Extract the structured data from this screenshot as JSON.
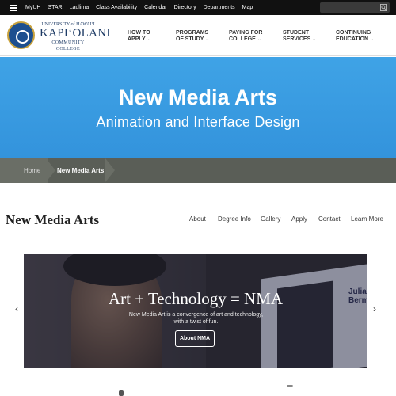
{
  "topbar": {
    "links": [
      "MyUH",
      "STAR",
      "Laulima",
      "Class Availability",
      "Calendar",
      "Directory",
      "Departments",
      "Map"
    ]
  },
  "logo": {
    "small": "UNIVERSITY of HAWAIʻI",
    "big": "KAPIʻOLANI",
    "cc": "COMMUNITY COLLEGE"
  },
  "mainnav": {
    "items": [
      {
        "line1": "HOW TO",
        "line2": "APPLY"
      },
      {
        "line1": "PROGRAMS",
        "line2": "OF STUDY"
      },
      {
        "line1": "PAYING FOR",
        "line2": "COLLEGE"
      },
      {
        "line1": "STUDENT",
        "line2": "SERVICES"
      },
      {
        "line1": "CONTINUING",
        "line2": "EDUCATION"
      }
    ]
  },
  "hero": {
    "title": "New Media Arts",
    "subtitle": "Animation and Interface Design"
  },
  "breadcrumb": {
    "home": "Home",
    "current": "New Media Arts"
  },
  "section": {
    "title": "New Media Arts",
    "links": [
      "About",
      "Degree Info",
      "Gallery",
      "Apply",
      "Contact",
      "Learn More"
    ]
  },
  "slider": {
    "headline": "Art + Technology = NMA",
    "caption": "New Media Art is a convergence of art and technology, with a twist of fun.",
    "button": "About NMA",
    "monitor_text": "Julian Berman"
  },
  "colors": {
    "hero": "#3a9be2",
    "breadcrumb": "#5a5e57",
    "topbar": "#111111"
  }
}
